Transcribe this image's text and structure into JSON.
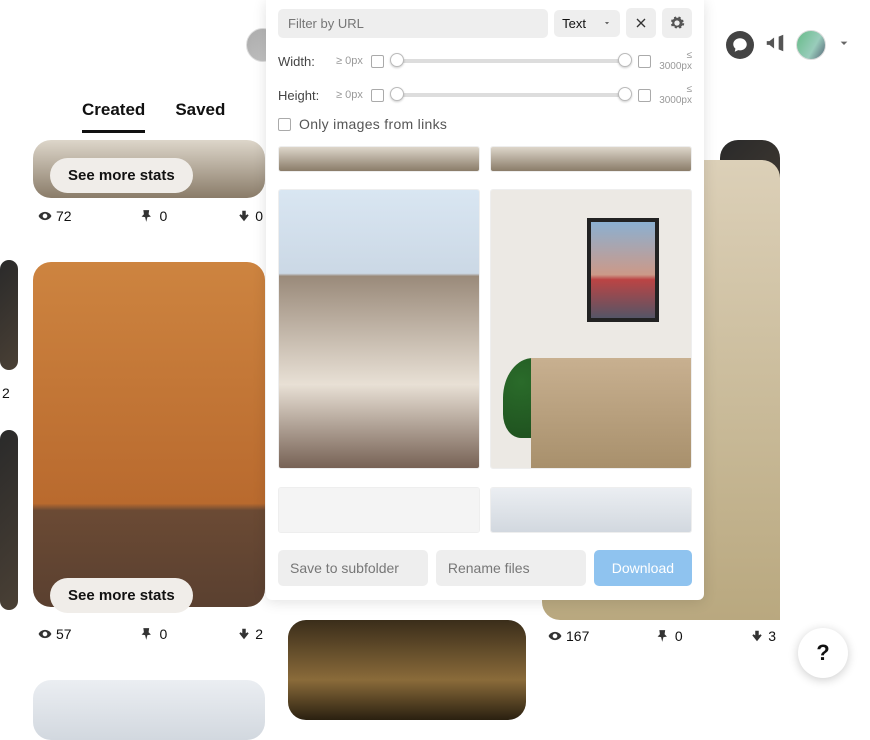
{
  "tabs": {
    "created": "Created",
    "saved": "Saved"
  },
  "modal": {
    "filter_placeholder": "Filter by URL",
    "select_label": "Text",
    "width_label": "Width:",
    "height_label": "Height:",
    "min_label": "≥ 0px",
    "max_label_top": "≤",
    "max_label_bottom": "3000px",
    "only_links": "Only images from links",
    "save_subfolder": "Save to subfolder",
    "rename_files": "Rename files",
    "download": "Download"
  },
  "buttons": {
    "see_more": "See more stats"
  },
  "stats": {
    "pinA": {
      "views": "72",
      "pins": "0",
      "clicks": "0"
    },
    "pinB": {
      "views": "57",
      "pins": "0",
      "clicks": "2"
    },
    "pinC": {
      "views": "167",
      "pins": "0",
      "clicks": "3"
    },
    "pinD": {
      "clicks": "0"
    },
    "pinE": {
      "num": "2"
    }
  },
  "help": "?"
}
